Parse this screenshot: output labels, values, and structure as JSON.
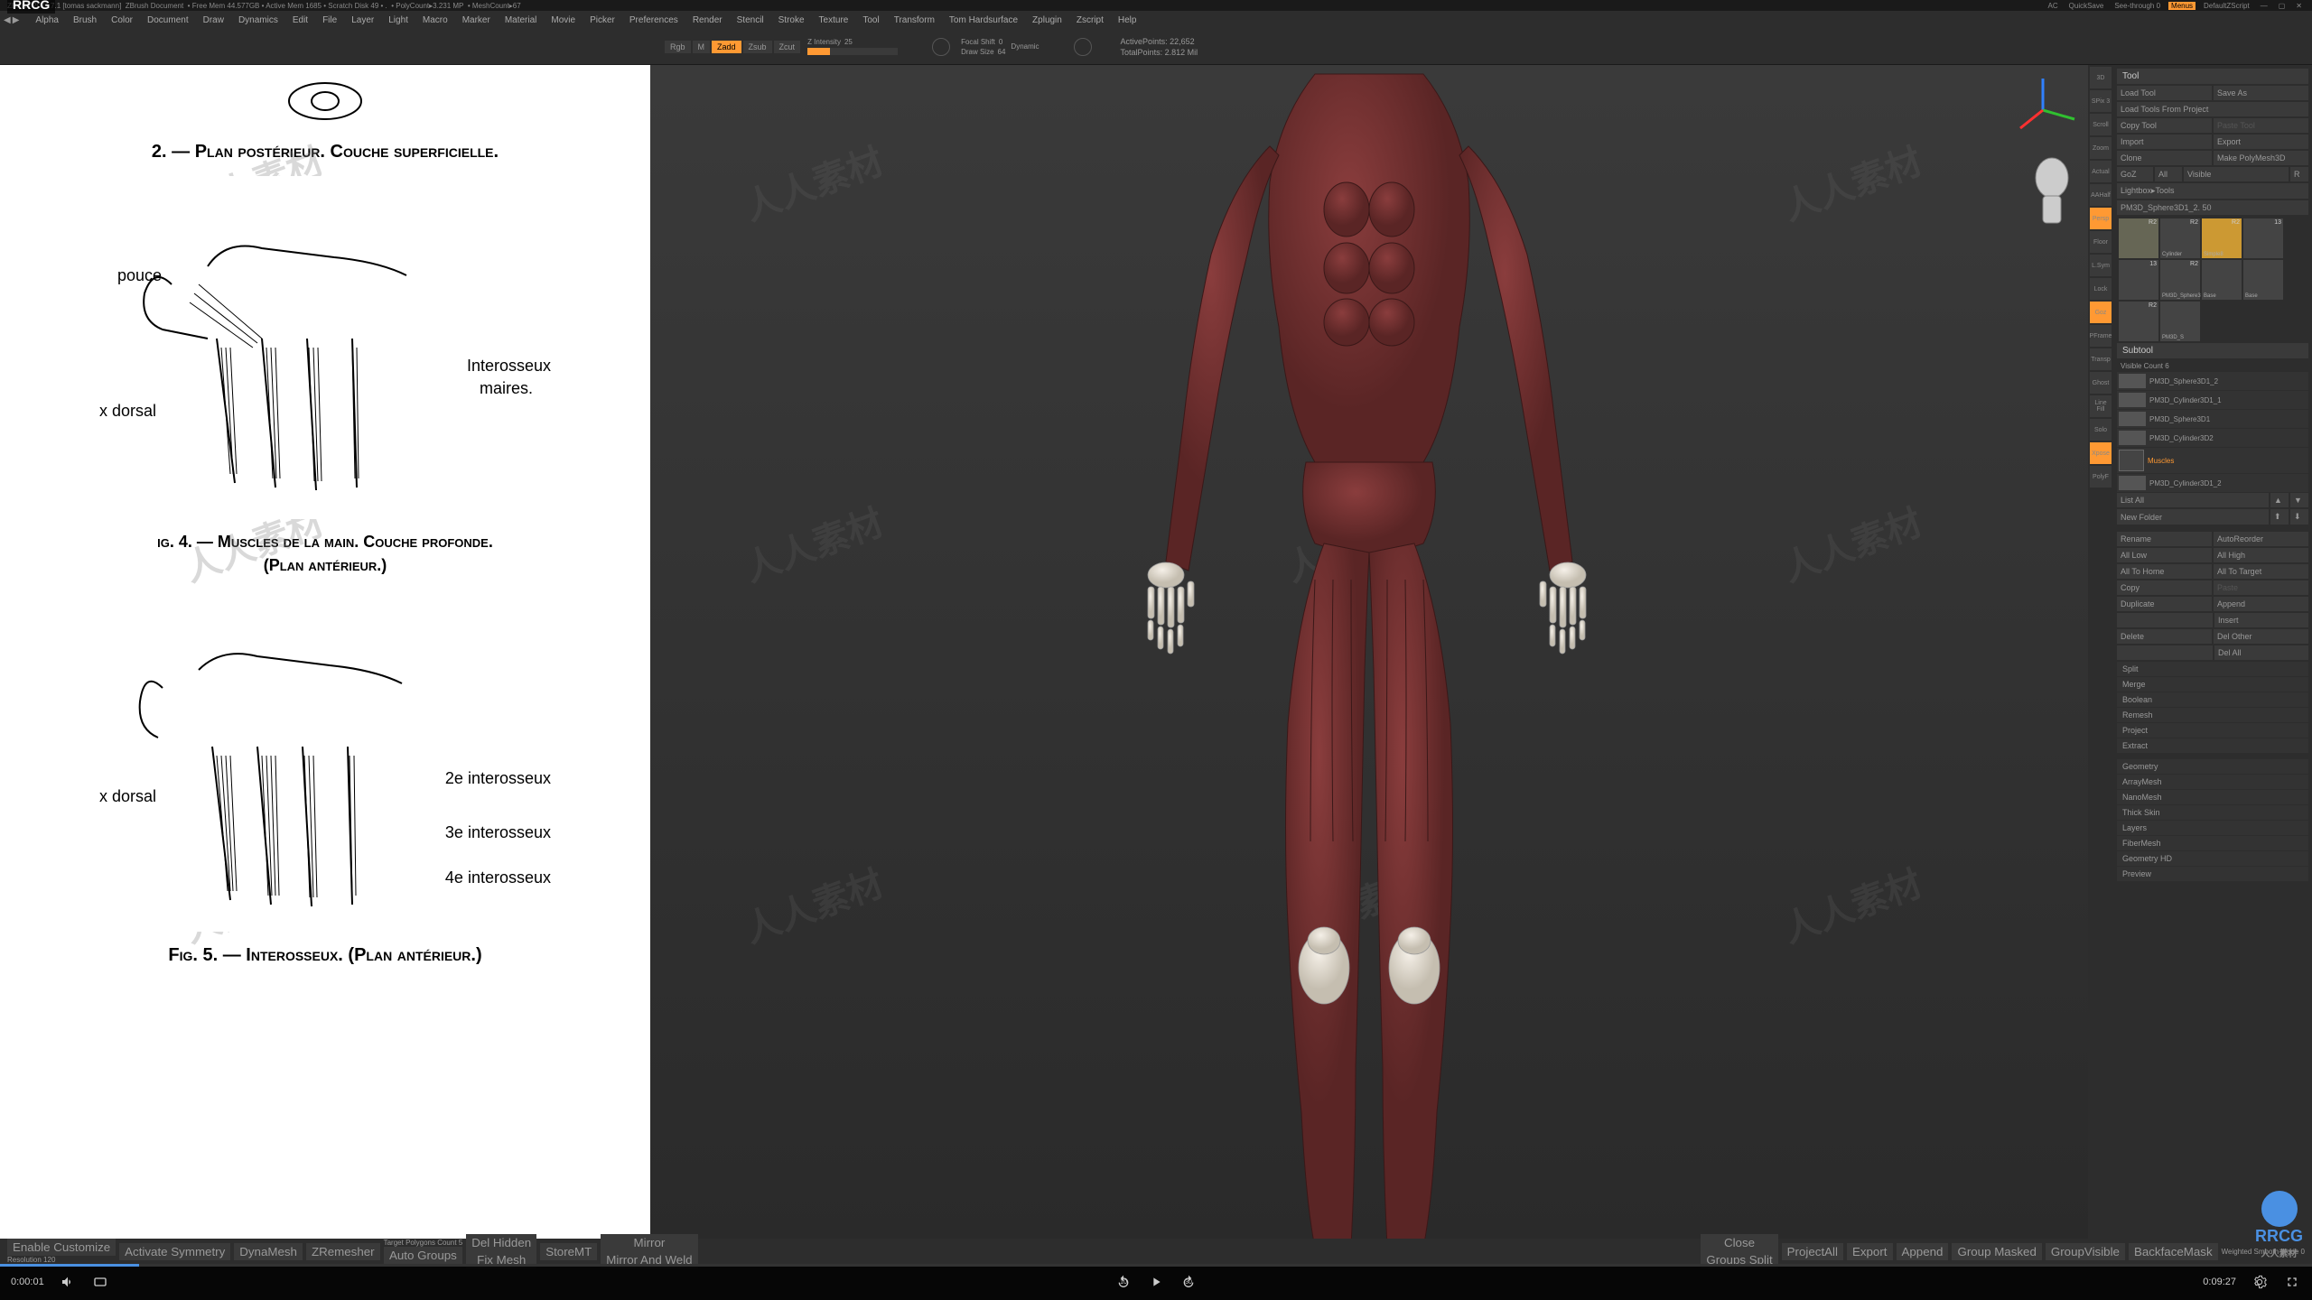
{
  "title_bar": {
    "app": "ZBrush 2021.7.1 [tomas sackmann]",
    "doc": "ZBrush Document",
    "mem": "• Free Mem 44.577GB • Active Mem 1685 • Scratch Disk 49 • .",
    "poly": "• PolyCount▸3.231 MP",
    "mesh": "• MeshCount▸67",
    "quicksave": "QuickSave",
    "seethrough": "See-through  0",
    "menus": "Menus",
    "defscript": "DefaultZScript"
  },
  "menu": [
    "Alpha",
    "Brush",
    "Color",
    "Document",
    "Draw",
    "Dynamics",
    "Edit",
    "File",
    "Layer",
    "Light",
    "Macro",
    "Marker",
    "Material",
    "Movie",
    "Picker",
    "Preferences",
    "Render",
    "Stencil",
    "Stroke",
    "Texture",
    "Tool",
    "Transform",
    "Tom Hardsurface",
    "Zplugin",
    "Zscript",
    "Help"
  ],
  "toolbar": {
    "modes": {
      "rgb": "Rgb",
      "m": "M",
      "zadd": "Zadd",
      "zsub": "Zsub",
      "zcut": "Zcut"
    },
    "zintensity_label": "Z Intensity",
    "zintensity_val": "25",
    "focal_label": "Focal Shift",
    "focal_val": "0",
    "drawsize_label": "Draw Size",
    "drawsize_val": "64",
    "dynamic": "Dynamic",
    "active_label": "ActivePoints:",
    "active_val": "22,652",
    "total_label": "TotalPoints:",
    "total_val": "2.812 Mil",
    "ac": "AC"
  },
  "reference": {
    "heading1": "2. — Plan postérieur. Couche superficielle.",
    "label1a": "pouce",
    "label1b": "x dorsal",
    "label1c": "Interosseux",
    "label1d": "maires.",
    "heading2": "ig. 4. — Muscles de la main. Couche profonde.",
    "heading2b": "(Plan antérieur.)",
    "label2a": "x dorsal",
    "label2b": "2e interosseux",
    "label2c": "3e interosseux",
    "label2d": "4e interosseux",
    "heading3": "Fig. 5. — Interosseux. (Plan antérieur.)"
  },
  "right_tools": [
    "3D",
    "SPix 3",
    "Scroll",
    "Zoom",
    "Actual",
    "AAHalf",
    "Persp",
    "Floor",
    "L.Sym",
    "Lock",
    "Goz",
    "PFrame",
    "Transp",
    "Ghost",
    "Line Fill",
    "Solo",
    "Xpose",
    "PolyF"
  ],
  "tool_panel": {
    "header": "Tool",
    "load": "Load Tool",
    "saveas": "Save As",
    "loadproj": "Load Tools From Project",
    "copy": "Copy Tool",
    "paste": "Paste Tool",
    "import": "Import",
    "export": "Export",
    "clone": "Clone",
    "makepoly": "Make PolyMesh3D",
    "goz": "GoZ",
    "all": "All",
    "visible": "Visible",
    "r": "R",
    "lightbox": "Lightbox▸Tools",
    "current": "PM3D_Sphere3D1_2. 50",
    "thumbs": [
      {
        "n": "R2",
        "name": ""
      },
      {
        "n": "R2",
        "name": "Cylinder"
      },
      {
        "n": "R2",
        "name": "Simple8"
      },
      {
        "n": "13",
        "name": ""
      },
      {
        "n": "13",
        "name": ""
      },
      {
        "n": "R2",
        "name": "PM3D_Sphere3"
      },
      {
        "n": "",
        "name": "Base"
      },
      {
        "n": "",
        "name": "Base"
      },
      {
        "n": "R2",
        "name": ""
      },
      {
        "n": "",
        "name": "PM3D_S"
      }
    ]
  },
  "subtool": {
    "header": "Subtool",
    "visible_count": "Visible Count 6",
    "items": [
      "PM3D_Sphere3D1_2",
      "PM3D_Cylinder3D1_1",
      "PM3D_Sphere3D1",
      "PM3D_Cylinder3D2",
      "Muscles",
      "PM3D_Cylinder3D1_2"
    ],
    "listall": "List All",
    "newfolder": "New Folder",
    "rename": "Rename",
    "autoreorder": "AutoReorder",
    "alllow": "All Low",
    "allhigh": "All High",
    "alltohome": "All To Home",
    "alltotarget": "All To Target",
    "copy": "Copy",
    "paste": "Paste",
    "duplicate": "Duplicate",
    "append": "Append",
    "insert": "Insert",
    "delete": "Delete",
    "delother": "Del Other",
    "delall": "Del All",
    "split": "Split",
    "merge": "Merge",
    "boolean": "Boolean",
    "remesh": "Remesh",
    "project": "Project",
    "extract": "Extract"
  },
  "sections": [
    "Geometry",
    "ArrayMesh",
    "NanoMesh",
    "Thick Skin",
    "Layers",
    "FiberMesh",
    "Geometry HD",
    "Preview"
  ],
  "bottom": {
    "enable_custom": "Enable Customize",
    "resolution": "Resolution",
    "resolution_val": "120",
    "activate_sym": "Activate Symmetry",
    "dynamesh": "DynaMesh",
    "zremesher": "ZRemesher",
    "target_poly": "Target Polygons Count",
    "target_val": "5",
    "autogroups": "Auto Groups",
    "delhidden": "Del Hidden",
    "fixmesh": "Fix Mesh",
    "storemt": "StoreMT",
    "mirrorweld": "Mirror And Weld",
    "mirror": "Mirror",
    "close": "Close",
    "groups_split": "Groups Split",
    "projectall": "ProjectAll",
    "export": "Export",
    "append": "Append",
    "groupmasked": "Group Masked",
    "groupvisible": "GroupVisible",
    "backfacemask": "BackfaceMask",
    "weighted": "Weighted Smooth Mode",
    "weighted_val": "0"
  },
  "video": {
    "time_current": "0:00:01",
    "time_total": "0:09:27",
    "skip_back": "10",
    "skip_fwd": "30"
  },
  "watermark": "人人素材",
  "rrcg": "RRCG",
  "rrcg_sub": "人人素材"
}
